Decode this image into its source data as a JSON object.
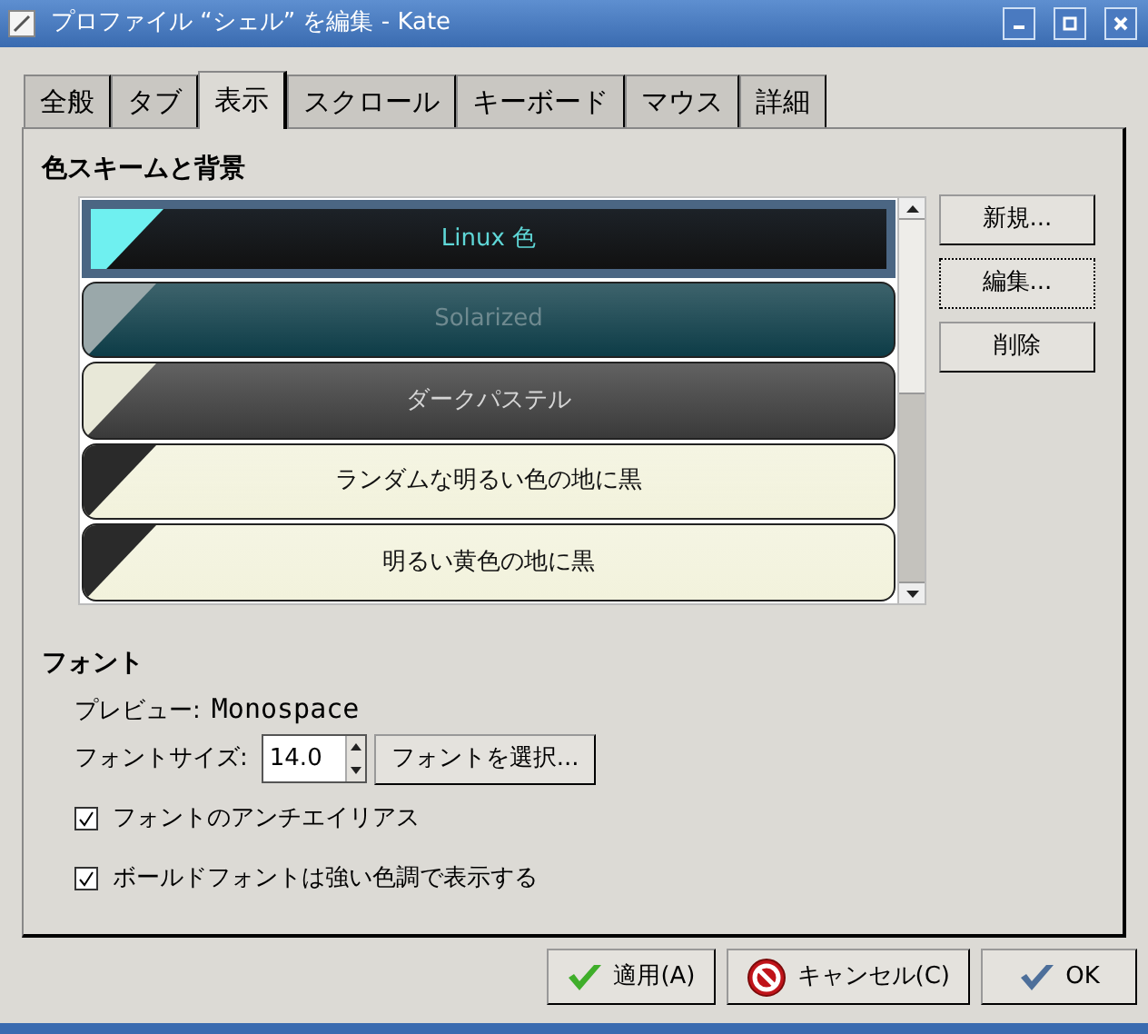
{
  "window": {
    "title": "プロファイル “シェル” を編集 - Kate"
  },
  "tabs": [
    {
      "label": "全般",
      "selected": false
    },
    {
      "label": "タブ",
      "selected": false
    },
    {
      "label": "表示",
      "selected": true
    },
    {
      "label": "スクロール",
      "selected": false
    },
    {
      "label": "キーボード",
      "selected": false
    },
    {
      "label": "マウス",
      "selected": false
    },
    {
      "label": "詳細",
      "selected": false
    }
  ],
  "color_scheme": {
    "heading": "色スキームと背景",
    "schemes": [
      {
        "name": "Linux 色",
        "selected": true,
        "color": "#111111",
        "kind": "cyan"
      },
      {
        "name": "Solarized",
        "selected": false,
        "color": "#0d3c47",
        "kind": "muted"
      },
      {
        "name": "ダークパステル",
        "selected": false,
        "color": "#3a3a3a",
        "kind": "dark"
      },
      {
        "name": "ランダムな明るい色の地に黒",
        "selected": false,
        "color": "#f2f2dc",
        "kind": "light"
      },
      {
        "name": "明るい黄色の地に黒",
        "selected": false,
        "color": "#f2f2dc",
        "kind": "light"
      }
    ],
    "buttons": [
      {
        "label": "新規...",
        "focused": false
      },
      {
        "label": "編集...",
        "focused": true
      },
      {
        "label": "削除",
        "focused": false
      }
    ]
  },
  "font": {
    "heading": "フォント",
    "preview_label": "プレビュー:",
    "preview_value": "Monospace",
    "size_label": "フォントサイズ:",
    "size_value": "14.0",
    "choose_button": "フォントを選択...",
    "options": [
      {
        "label": "フォントのアンチエイリアス",
        "checked": true
      },
      {
        "label": "ボールドフォントは強い色調で表示する",
        "checked": true
      }
    ]
  },
  "buttons": [
    {
      "label": "適用(A)",
      "kind": "apply"
    },
    {
      "label": "キャンセル(C)",
      "kind": "cancel"
    },
    {
      "label": "OK",
      "kind": "ok"
    }
  ]
}
